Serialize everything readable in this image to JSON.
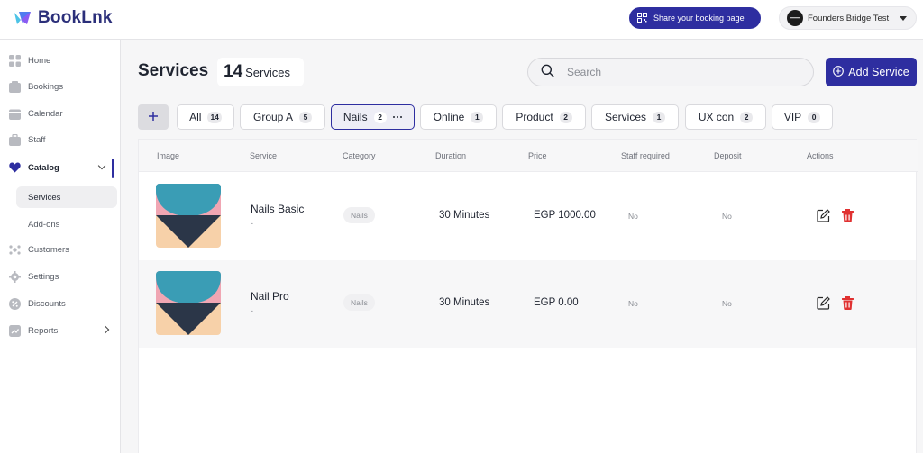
{
  "app": {
    "name": "BookLnk"
  },
  "topbar": {
    "share_label": "Share your booking page",
    "account_name": "Founders Bridge Test"
  },
  "sidebar": {
    "items": [
      {
        "label": "Home",
        "icon": "grid-icon"
      },
      {
        "label": "Bookings",
        "icon": "bookings-icon"
      },
      {
        "label": "Calendar",
        "icon": "calendar-icon"
      },
      {
        "label": "Staff",
        "icon": "staff-icon"
      },
      {
        "label": "Catalog",
        "icon": "heart-icon",
        "active": true,
        "expanded": true
      },
      {
        "label": "Customers",
        "icon": "customers-icon"
      },
      {
        "label": "Settings",
        "icon": "gear-icon"
      },
      {
        "label": "Discounts",
        "icon": "discount-icon"
      },
      {
        "label": "Reports",
        "icon": "reports-icon"
      }
    ],
    "catalog_sub": [
      {
        "label": "Services",
        "selected": true
      },
      {
        "label": "Add-ons"
      }
    ]
  },
  "header": {
    "title": "Services",
    "count": "14",
    "count_label": "Services",
    "search_placeholder": "Search",
    "add_label": "Add Service"
  },
  "filters": [
    {
      "label": "All",
      "count": "14"
    },
    {
      "label": "Group A",
      "count": "5"
    },
    {
      "label": "Nails",
      "count": "2",
      "selected": true
    },
    {
      "label": "Online",
      "count": "1"
    },
    {
      "label": "Product",
      "count": "2"
    },
    {
      "label": "Services",
      "count": "1"
    },
    {
      "label": "UX con",
      "count": "2"
    },
    {
      "label": "VIP",
      "count": "0"
    }
  ],
  "table": {
    "columns": [
      "Image",
      "Service",
      "Category",
      "Duration",
      "Price",
      "Staff required",
      "Deposit",
      "Actions"
    ],
    "rows": [
      {
        "name": "Nails Basic",
        "sub": "-",
        "category": "Nails",
        "duration": "30 Minutes",
        "price": "EGP 1000.00",
        "staff_required": "No",
        "deposit": "No"
      },
      {
        "name": "Nail Pro",
        "sub": "-",
        "category": "Nails",
        "duration": "30 Minutes",
        "price": "EGP 0.00",
        "staff_required": "No",
        "deposit": "No"
      }
    ]
  },
  "colors": {
    "primary": "#2e2ea0",
    "delete": "#e03131",
    "thumb_teal": "#3a9db5",
    "thumb_pink": "#f0a6b3",
    "thumb_peach": "#f7d1a9",
    "thumb_navy": "#2b3648"
  }
}
